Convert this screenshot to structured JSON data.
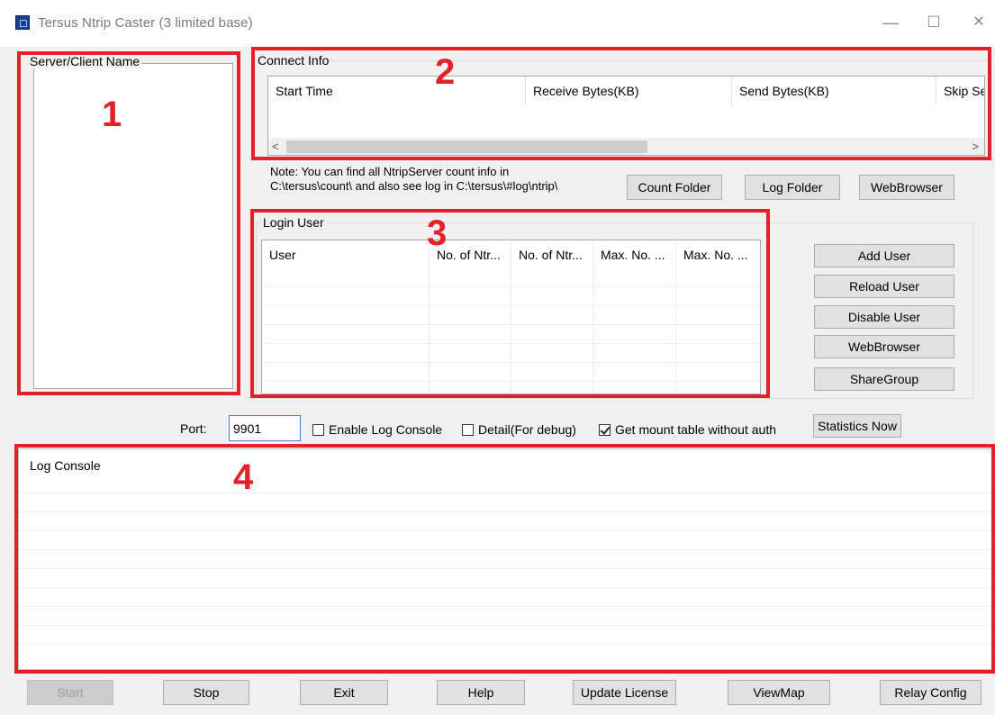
{
  "window": {
    "title": "Tersus Ntrip Caster  (3 limited base)",
    "minimize": "—",
    "maximize": "☐",
    "close": "✕"
  },
  "server_client": {
    "label": "Server/Client Name"
  },
  "connect_info": {
    "label": "Connect Info",
    "columns": [
      "Start Time",
      "Receive Bytes(KB)",
      "Send Bytes(KB)",
      "Skip Se"
    ],
    "scroll_left": "<",
    "scroll_right": ">"
  },
  "note": {
    "line1": "Note: You can find all NtripServer count info in",
    "line2": "C:\\tersus\\count\\ and also see log in C:\\tersus\\#log\\ntrip\\"
  },
  "folder_buttons": {
    "count_folder": "Count Folder",
    "log_folder": "Log Folder",
    "web_browser": "WebBrowser"
  },
  "login_user": {
    "label": "Login User",
    "columns": [
      "User",
      "No. of Ntr...",
      "No. of Ntr...",
      "Max. No. ...",
      "Max. No. ..."
    ]
  },
  "user_buttons": {
    "add_user": "Add User",
    "reload_user": "Reload User",
    "disable_user": "Disable User",
    "web_browser": "WebBrowser",
    "share_group": "ShareGroup"
  },
  "options": {
    "port_label": "Port:",
    "port_value": "9901",
    "enable_log_console": "Enable Log Console",
    "enable_log_console_checked": false,
    "detail": "Detail(For debug)",
    "detail_checked": false,
    "mount_table": "Get mount table without auth",
    "mount_table_checked": true,
    "statistics_now": "Statistics Now"
  },
  "log_console": {
    "label": "Log Console"
  },
  "bottom_buttons": {
    "start": "Start",
    "stop": "Stop",
    "exit": "Exit",
    "help": "Help",
    "update_license": "Update License",
    "view_map": "ViewMap",
    "relay_config": "Relay Config"
  },
  "annotations": [
    "1",
    "2",
    "3",
    "4"
  ],
  "colors": {
    "annotation_red": "#e4202a",
    "window_bg": "#f0f0f0",
    "button_bg": "#e1e1e1"
  }
}
